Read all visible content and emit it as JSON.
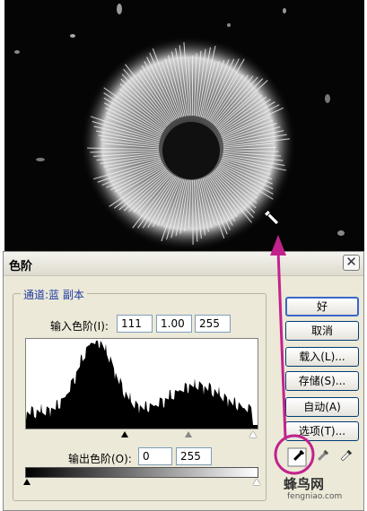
{
  "dialog": {
    "title": "色阶",
    "close_glyph": "✕",
    "channel_label": "通道:蓝 副本",
    "input_levels_label": "输入色阶(I):",
    "input_levels": {
      "black": "111",
      "gamma": "1.00",
      "white": "255"
    },
    "output_levels_label": "输出色阶(O):",
    "output_levels": {
      "black": "0",
      "white": "255"
    }
  },
  "buttons": {
    "ok": "好",
    "cancel": "取消",
    "load": "载入(L)...",
    "save": "存储(S)...",
    "auto": "自动(A)",
    "options": "选项(T)..."
  },
  "icons": {
    "black_eyedropper": "eyedropper-black-icon",
    "gray_eyedropper": "eyedropper-gray-icon",
    "white_eyedropper": "eyedropper-white-icon"
  },
  "annotation": {
    "color": "#c2228c"
  },
  "watermark": {
    "text": "蜂鸟网",
    "sub": "fengniao.com"
  }
}
